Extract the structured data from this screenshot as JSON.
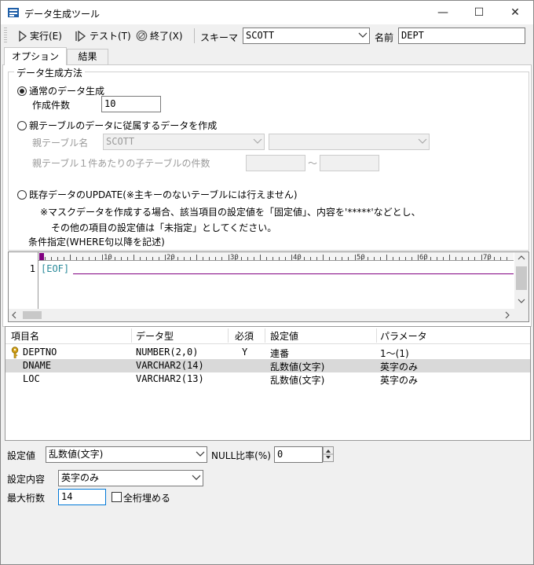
{
  "window": {
    "title": "データ生成ツール",
    "min_glyph": "—",
    "max_glyph": "☐",
    "close_glyph": "✕"
  },
  "toolbar": {
    "run_label": "実行(E)",
    "test_label": "テスト(T)",
    "exit_label": "終了(X)",
    "schema_label": "スキーマ",
    "schema_value": "SCOTT",
    "name_label": "名前",
    "name_value": "DEPT"
  },
  "tabs": [
    {
      "label": "オプション",
      "active": true
    },
    {
      "label": "結果",
      "active": false
    }
  ],
  "options": {
    "group_title": "データ生成方法",
    "radio_normal": "通常のデータ生成",
    "count_label": "作成件数",
    "count_value": "10",
    "radio_parent": "親テーブルのデータに従属するデータを作成",
    "parent_table_label": "親テーブル名",
    "parent_table_value": "SCOTT",
    "child_count_label": "親テーブル１件あたりの子テーブルの件数",
    "range_sep": "〜",
    "radio_update": "既存データのUPDATE(※主キーのないテーブルには行えません)",
    "note_line1": "※マスクデータを作成する場合、該当項目の設定値を「固定値」、内容を'*****'などとし、",
    "note_line2": "その他の項目の設定値は「未指定」としてください。",
    "where_label": "条件指定(WHERE句以降を記述)"
  },
  "editor": {
    "ruler_ticks": [
      "10",
      "20",
      "30",
      "40",
      "50",
      "60",
      "70"
    ],
    "line_number": "1",
    "eof_text": "[EOF]"
  },
  "grid": {
    "headers": [
      "項目名",
      "データ型",
      "必須",
      "設定値",
      "パラメータ"
    ],
    "rows": [
      {
        "name": "DEPTNO",
        "type": "NUMBER(2,0)",
        "required": "Y",
        "setting": "連番",
        "param": "1〜(1)",
        "key": true,
        "selected": false
      },
      {
        "name": "DNAME",
        "type": "VARCHAR2(14)",
        "required": "",
        "setting": "乱数値(文字)",
        "param": "英字のみ",
        "key": false,
        "selected": true
      },
      {
        "name": "LOC",
        "type": "VARCHAR2(13)",
        "required": "",
        "setting": "乱数値(文字)",
        "param": "英字のみ",
        "key": false,
        "selected": false
      }
    ]
  },
  "bottom": {
    "setting_label": "設定値",
    "setting_value": "乱数値(文字)",
    "null_ratio_label": "NULL比率(%)",
    "null_ratio_value": "0",
    "content_label": "設定内容",
    "content_value": "英字のみ",
    "max_digits_label": "最大桁数",
    "max_digits_value": "14",
    "fill_all_label": "全桁埋める"
  },
  "colors": {
    "selected_row": "#d9d9d9",
    "eof_text": "#2a8a9a",
    "cursor_line": "#800080",
    "key_icon": "#d4a017"
  }
}
